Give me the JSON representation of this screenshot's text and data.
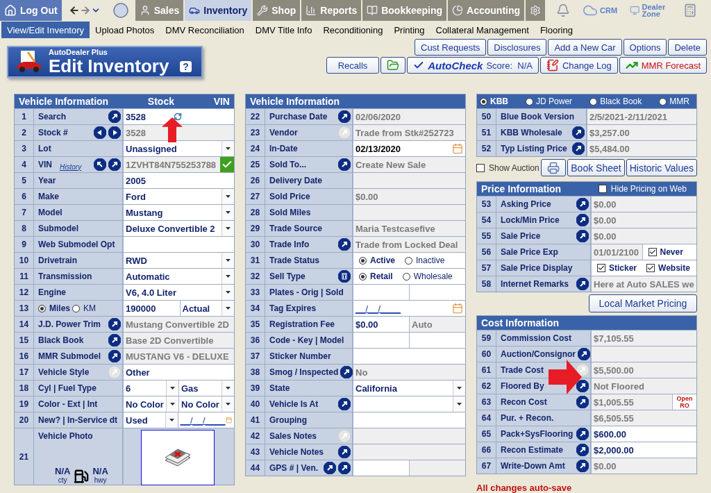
{
  "nav": {
    "logout": "Log Out",
    "tabs": [
      {
        "kind": "sales",
        "label": "Sales",
        "selected": false
      },
      {
        "kind": "inventory",
        "label": "Inventory",
        "selected": true
      },
      {
        "kind": "shop",
        "label": "Shop",
        "selected": false
      },
      {
        "kind": "reports",
        "label": "Reports",
        "selected": false
      },
      {
        "kind": "bookkeeping",
        "label": "Bookkeeping",
        "selected": false
      },
      {
        "kind": "accounting",
        "label": "Accounting",
        "selected": false
      },
      {
        "kind": "settings",
        "selected": false
      }
    ],
    "tools": [
      {
        "kind": "bell"
      },
      {
        "kind": "crm",
        "label": "CRM"
      },
      {
        "kind": "zone",
        "label": "Dealer Zone"
      },
      {
        "kind": "calculator"
      }
    ]
  },
  "subnav": [
    {
      "label": "View/Edit Inventory",
      "selected": true
    },
    {
      "label": "Upload Photos",
      "selected": false
    },
    {
      "label": "DMV Reconciliation",
      "selected": false
    },
    {
      "label": "DMV Title Info",
      "selected": false
    },
    {
      "label": "Reconditioning",
      "selected": false
    },
    {
      "label": "Printing",
      "selected": false
    },
    {
      "label": "Collateral Management",
      "selected": false
    },
    {
      "label": "Flooring",
      "selected": false
    }
  ],
  "header": {
    "brand": "AutoDealer Plus",
    "title": "Edit Inventory",
    "help": "?"
  },
  "actions": {
    "row1": [
      "Cust Requests",
      "Disclosures",
      "Add a New Car",
      "Options",
      "Delete"
    ],
    "row2": [
      {
        "kind": "plain",
        "label": "Recalls"
      },
      {
        "kind": "folder"
      },
      {
        "kind": "autocheck",
        "label": "AutoCheck",
        "score": "Score:  N/A"
      },
      {
        "kind": "log",
        "label": "Change Log"
      },
      {
        "kind": "mmr",
        "label": "MMR Forecast"
      }
    ]
  },
  "left": {
    "headers": [
      "Vehicle Information",
      "Stock",
      "VIN"
    ],
    "rows": [
      {
        "num": "1",
        "label": "Search",
        "buttons": [
          {
            "kind": "go",
            "disabled": false
          }
        ],
        "cells": [
          {
            "kind": "input",
            "value": "3528",
            "refresh": true
          }
        ]
      },
      {
        "num": "2",
        "label": "Stock #",
        "buttons": [
          {
            "kind": "prev",
            "disabled": false
          },
          {
            "kind": "next",
            "disabled": false
          }
        ],
        "cells": [
          {
            "kind": "readonly",
            "value": "3528"
          }
        ]
      },
      {
        "num": "3",
        "label": "Lot",
        "cells": [
          {
            "kind": "select",
            "value": "Unassigned"
          }
        ]
      },
      {
        "num": "4",
        "label": "VIN",
        "link": "History",
        "buttons": [
          {
            "kind": "up",
            "disabled": false
          },
          {
            "kind": "go",
            "disabled": false
          }
        ],
        "cells": [
          {
            "kind": "readonly",
            "value": "1ZVHT84N755253788",
            "verified": true
          }
        ]
      },
      {
        "num": "5",
        "label": "Year",
        "cells": [
          {
            "kind": "input",
            "value": "2005"
          }
        ]
      },
      {
        "num": "6",
        "label": "Make",
        "cells": [
          {
            "kind": "select",
            "value": "Ford"
          }
        ]
      },
      {
        "num": "7",
        "label": "Model",
        "cells": [
          {
            "kind": "select",
            "value": "Mustang"
          }
        ]
      },
      {
        "num": "8",
        "label": "Submodel",
        "cells": [
          {
            "kind": "select",
            "value": "Deluxe Convertible 2"
          }
        ]
      },
      {
        "num": "9",
        "label": "Web Submodel Opt",
        "cells": [
          {
            "kind": "input"
          }
        ]
      },
      {
        "num": "10",
        "label": "Drivetrain",
        "cells": [
          {
            "kind": "select",
            "value": "RWD"
          }
        ]
      },
      {
        "num": "11",
        "label": "Transmission",
        "cells": [
          {
            "kind": "select",
            "value": "Automatic"
          }
        ]
      },
      {
        "num": "12",
        "label": "Engine",
        "cells": [
          {
            "kind": "select",
            "value": "V6, 4.0 Liter"
          }
        ]
      },
      {
        "num": "13",
        "units": [
          {
            "label": "Miles",
            "selected": true
          },
          {
            "label": "KM",
            "selected": false
          }
        ],
        "cells": [
          {
            "kind": "input",
            "value": "190000"
          },
          {
            "kind": "select",
            "value": "Actual"
          }
        ]
      },
      {
        "num": "14",
        "label": "J.D. Power Trim",
        "buttons": [
          {
            "kind": "go",
            "disabled": false
          }
        ],
        "cells": [
          {
            "kind": "readonly",
            "value": "Mustang Convertible 2D"
          }
        ]
      },
      {
        "num": "15",
        "label": "Black Book",
        "buttons": [
          {
            "kind": "go",
            "disabled": false
          }
        ],
        "cells": [
          {
            "kind": "readonly",
            "value": "Base 2D Convertible"
          }
        ]
      },
      {
        "num": "16",
        "label": "MMR Submodel",
        "buttons": [
          {
            "kind": "go",
            "disabled": false
          }
        ],
        "cells": [
          {
            "kind": "readonly",
            "value": "MUSTANG V6 - DELUXE"
          }
        ]
      },
      {
        "num": "17",
        "label": "Vehicle Style",
        "buttons": [
          {
            "kind": "go",
            "disabled": true
          }
        ],
        "cells": [
          {
            "kind": "input",
            "value": "Other"
          }
        ]
      },
      {
        "num": "18",
        "label": "Cyl | Fuel Type",
        "cells": [
          {
            "kind": "select",
            "value": "6"
          },
          {
            "kind": "select",
            "value": "Gas"
          }
        ]
      },
      {
        "num": "19",
        "label": "Color - Ext | Int",
        "cells": [
          {
            "kind": "select",
            "value": "No Color"
          },
          {
            "kind": "select",
            "value": "No Color"
          }
        ]
      },
      {
        "num": "20",
        "label": "New? | In-Service dt",
        "cells": [
          {
            "kind": "select",
            "value": "Used"
          },
          {
            "kind": "date",
            "value": "__/__/____"
          }
        ]
      },
      {
        "num": "21",
        "label": "Vehicle Photo",
        "mpg": [
          {
            "value": "N/A",
            "unit": "cty"
          },
          {
            "value": "N/A",
            "unit": "hwy"
          }
        ],
        "cells": [
          {
            "kind": "photo"
          }
        ]
      }
    ]
  },
  "middle": {
    "headers": [
      "Vehicle Information"
    ],
    "rows": [
      {
        "num": "22",
        "label": "Purchase Date",
        "buttons": [
          {
            "kind": "go",
            "disabled": false
          }
        ],
        "cells": [
          {
            "kind": "readonly",
            "value": "02/06/2020"
          }
        ]
      },
      {
        "num": "23",
        "label": "Vendor",
        "buttons": [
          {
            "kind": "go",
            "disabled": true
          }
        ],
        "cells": [
          {
            "kind": "readonly",
            "value": "Trade from  Stk#252723"
          }
        ]
      },
      {
        "num": "24",
        "label": "In-Date",
        "cells": [
          {
            "kind": "date",
            "value": "02/13/2020",
            "filled": true
          }
        ]
      },
      {
        "num": "25",
        "label": "Sold To...",
        "buttons": [
          {
            "kind": "go",
            "disabled": false
          }
        ],
        "cells": [
          {
            "kind": "readonly",
            "value": "Create New Sale"
          }
        ]
      },
      {
        "num": "26",
        "label": "Delivery Date",
        "cells": [
          {
            "kind": "readonly"
          }
        ]
      },
      {
        "num": "27",
        "label": "Sold Price",
        "cells": [
          {
            "kind": "readonly",
            "value": "$0.00"
          }
        ]
      },
      {
        "num": "28",
        "label": "Sold Miles",
        "cells": [
          {
            "kind": "readonly"
          }
        ]
      },
      {
        "num": "29",
        "label": "Trade Source",
        "cells": [
          {
            "kind": "readonly",
            "value": "Maria Testcasefive"
          }
        ]
      },
      {
        "num": "30",
        "label": "Trade Info",
        "buttons": [
          {
            "kind": "go",
            "disabled": false
          }
        ],
        "cells": [
          {
            "kind": "readonly",
            "value": "Trade from Locked Deal"
          }
        ]
      },
      {
        "num": "31",
        "label": "Trade Status",
        "cells": [
          {
            "kind": "radios",
            "options": [
              {
                "label": "Active",
                "selected": true
              },
              {
                "label": "Inactive",
                "selected": false
              }
            ]
          }
        ]
      },
      {
        "num": "32",
        "label": "Sell Type",
        "buttons": [
          {
            "kind": "trash",
            "disabled": false
          }
        ],
        "cells": [
          {
            "kind": "radios",
            "options": [
              {
                "label": "Retail",
                "selected": true
              },
              {
                "label": "Wholesale",
                "selected": false
              }
            ]
          }
        ]
      },
      {
        "num": "33",
        "label": "Plates - Orig | Sold",
        "cells": [
          {
            "kind": "input"
          },
          {
            "kind": "input"
          }
        ]
      },
      {
        "num": "34",
        "label": "Tag Expires",
        "cells": [
          {
            "kind": "date",
            "value": "__/__/____"
          }
        ]
      },
      {
        "num": "35",
        "label": "Registration Fee",
        "cells": [
          {
            "kind": "input",
            "value": "$0.00"
          },
          {
            "kind": "readonly",
            "value": "Auto"
          }
        ]
      },
      {
        "num": "36",
        "label": "Code - Key | Model",
        "cells": [
          {
            "kind": "input"
          },
          {
            "kind": "input"
          }
        ]
      },
      {
        "num": "37",
        "label": "Sticker Number",
        "cells": [
          {
            "kind": "input"
          }
        ]
      },
      {
        "num": "38",
        "label": "Smog / Inspected",
        "buttons": [
          {
            "kind": "go",
            "disabled": false
          }
        ],
        "cells": [
          {
            "kind": "readonly",
            "value": "No"
          }
        ]
      },
      {
        "num": "39",
        "label": "State",
        "cells": [
          {
            "kind": "select",
            "value": "California"
          }
        ]
      },
      {
        "num": "40",
        "label": "Vehicle Is At",
        "buttons": [
          {
            "kind": "go",
            "disabled": false
          }
        ],
        "cells": [
          {
            "kind": "select"
          }
        ]
      },
      {
        "num": "41",
        "label": "Grouping",
        "cells": [
          {
            "kind": "input"
          }
        ]
      },
      {
        "num": "42",
        "label": "Sales Notes",
        "buttons": [
          {
            "kind": "go",
            "disabled": true
          }
        ],
        "cells": [
          {
            "kind": "readonly"
          }
        ]
      },
      {
        "num": "43",
        "label": "Vehicle Notes",
        "buttons": [
          {
            "kind": "go",
            "disabled": false
          }
        ],
        "cells": [
          {
            "kind": "readonly"
          }
        ]
      },
      {
        "num": "44",
        "label": "GPS # | Ven.",
        "buttons": [
          {
            "kind": "go",
            "disabled": false
          },
          {
            "kind": "go",
            "disabled": false
          }
        ],
        "cells": [
          {
            "kind": "input"
          },
          {
            "kind": "readonly"
          }
        ]
      }
    ]
  },
  "right": {
    "book_sources": [
      {
        "label": "KBB",
        "selected": true
      },
      {
        "label": "JD Power",
        "selected": false
      },
      {
        "label": "Black Book",
        "selected": false
      },
      {
        "label": "MMR",
        "selected": false
      }
    ],
    "book_rows": [
      {
        "num": "50",
        "label": "Blue Book Version",
        "cells": [
          {
            "kind": "readonly",
            "value": "2/5/2021-2/11/2021"
          }
        ]
      },
      {
        "num": "51",
        "label": "KBB Wholesale",
        "buttons": [
          {
            "kind": "go",
            "disabled": false
          }
        ],
        "cells": [
          {
            "kind": "readonly",
            "value": "$3,257.00"
          }
        ]
      },
      {
        "num": "52",
        "label": "Typ Listing Price",
        "buttons": [
          {
            "kind": "go",
            "disabled": false
          }
        ],
        "cells": [
          {
            "kind": "readonly",
            "value": "$5,484.00"
          }
        ]
      }
    ],
    "show_auction": {
      "label": "Show Auction",
      "checked": false
    },
    "book_buttons": [
      "Book Sheet",
      "Historic Values"
    ],
    "price": {
      "title": "Price Information",
      "hide": {
        "label": "Hide Pricing on Web",
        "checked": false
      },
      "rows": [
        {
          "num": "53",
          "label": "Asking Price",
          "buttons": [
            {
              "kind": "go",
              "disabled": false
            }
          ],
          "cells": [
            {
              "kind": "readonly",
              "value": "$0.00"
            }
          ]
        },
        {
          "num": "54",
          "label": "Lock/Min Price",
          "buttons": [
            {
              "kind": "go",
              "disabled": false
            }
          ],
          "cells": [
            {
              "kind": "readonly",
              "value": "$0.00"
            }
          ]
        },
        {
          "num": "55",
          "label": "Sale Price",
          "buttons": [
            {
              "kind": "go",
              "disabled": false
            }
          ],
          "cells": [
            {
              "kind": "readonly",
              "value": "$0.00"
            }
          ]
        },
        {
          "num": "56",
          "label": "Sale Price Exp",
          "cells": [
            {
              "kind": "readonly",
              "value": "01/01/2100"
            },
            {
              "kind": "checks",
              "options": [
                {
                  "label": "Never",
                  "checked": true
                }
              ]
            }
          ]
        },
        {
          "num": "57",
          "label": "Sale Price Display",
          "cells": [
            {
              "kind": "checks",
              "options": [
                {
                  "label": "Sticker",
                  "checked": true
                },
                {
                  "label": "Website",
                  "checked": true
                }
              ]
            }
          ]
        },
        {
          "num": "58",
          "label": "Internet Remarks",
          "buttons": [
            {
              "kind": "go",
              "disabled": false
            }
          ],
          "cells": [
            {
              "kind": "readonly",
              "value": "Here at Auto SALES we"
            }
          ]
        }
      ],
      "button": "Local Market Pricing"
    },
    "cost": {
      "title": "Cost Information",
      "rows": [
        {
          "num": "59",
          "label": "Commission Cost",
          "cells": [
            {
              "kind": "readonly",
              "value": "$7,105.55"
            }
          ]
        },
        {
          "num": "60",
          "label": "Auction/Consignor",
          "buttons": [
            {
              "kind": "go",
              "disabled": false
            }
          ],
          "cells": [
            {
              "kind": "readonly"
            }
          ]
        },
        {
          "num": "61",
          "label": "Trade Cost",
          "buttons": [
            {
              "kind": "go",
              "disabled": true
            }
          ],
          "cells": [
            {
              "kind": "readonly",
              "value": "$5,500.00"
            }
          ]
        },
        {
          "num": "62",
          "label": "Floored By",
          "buttons": [
            {
              "kind": "go",
              "disabled": false
            }
          ],
          "cells": [
            {
              "kind": "readonly",
              "value": "Not Floored"
            }
          ]
        },
        {
          "num": "63",
          "label": "Recon Cost",
          "buttons": [
            {
              "kind": "go",
              "disabled": false
            }
          ],
          "cells": [
            {
              "kind": "readonly",
              "value": "$1,005.55"
            },
            {
              "kind": "ro",
              "value": "Open RO"
            }
          ]
        },
        {
          "num": "64",
          "label": "Pur. + Recon.",
          "cells": [
            {
              "kind": "readonly",
              "value": "$6,505.55"
            }
          ]
        },
        {
          "num": "65",
          "label": "Pack+SysFlooring",
          "buttons": [
            {
              "kind": "go",
              "disabled": false
            }
          ],
          "cells": [
            {
              "kind": "input",
              "value": "$600.00"
            }
          ]
        },
        {
          "num": "66",
          "label": "Recon Estimate",
          "buttons": [
            {
              "kind": "go",
              "disabled": false
            }
          ],
          "cells": [
            {
              "kind": "input",
              "value": "$2,000.00"
            }
          ]
        },
        {
          "num": "67",
          "label": "Write-Down Amt",
          "buttons": [
            {
              "kind": "go",
              "disabled": false
            }
          ],
          "cells": [
            {
              "kind": "readonly",
              "value": "$0.00"
            }
          ]
        }
      ]
    },
    "footer": "All changes auto-save"
  }
}
